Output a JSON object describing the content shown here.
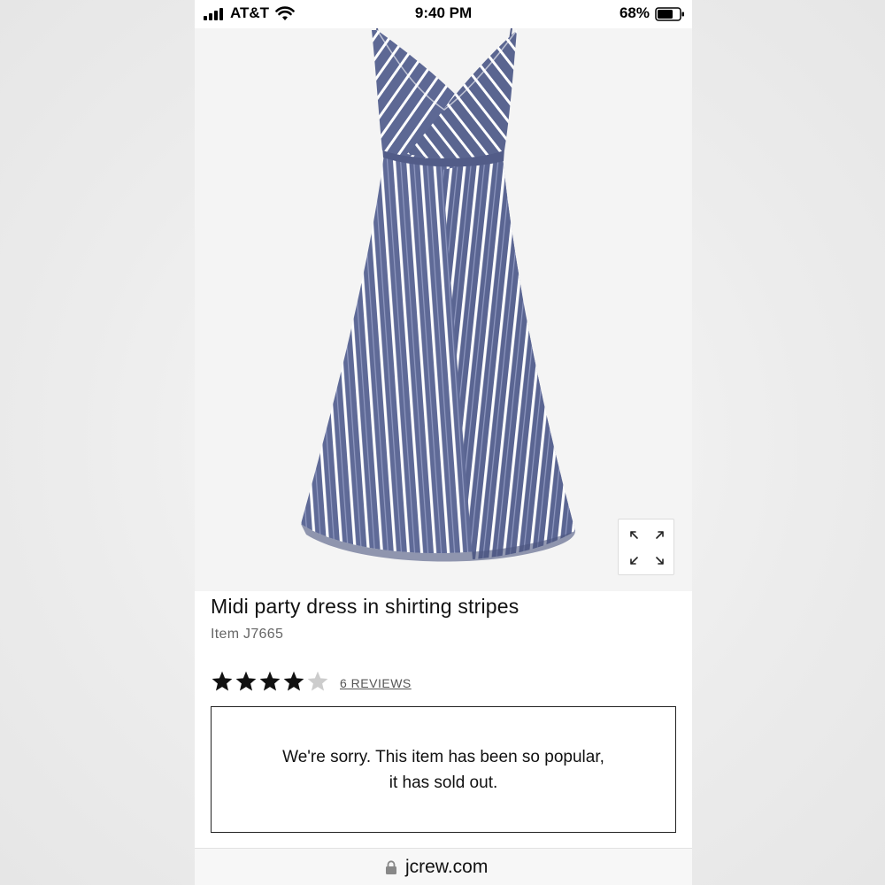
{
  "status_bar": {
    "carrier": "AT&T",
    "time": "9:40 PM",
    "battery_percent": "68%",
    "icons": [
      "signal-bars-icon",
      "wifi-icon",
      "battery-icon"
    ]
  },
  "product": {
    "image_description_icon": "dress-image",
    "expand_icon": "expand-arrows-icon",
    "title": "Midi party dress in shirting stripes",
    "item_number": "Item J7665",
    "rating": 4,
    "rating_max": 5,
    "reviews_label": "6 REVIEWS",
    "sold_out_line1": "We're sorry. This item has been so popular,",
    "sold_out_line2": "it has sold out."
  },
  "browser": {
    "url": "jcrew.com",
    "lock_icon": "lock-icon"
  },
  "colors": {
    "dress_blue": "#5f6a97",
    "dress_stripe": "#ffffff",
    "star_filled": "#111111",
    "star_empty": "#cccccc"
  }
}
